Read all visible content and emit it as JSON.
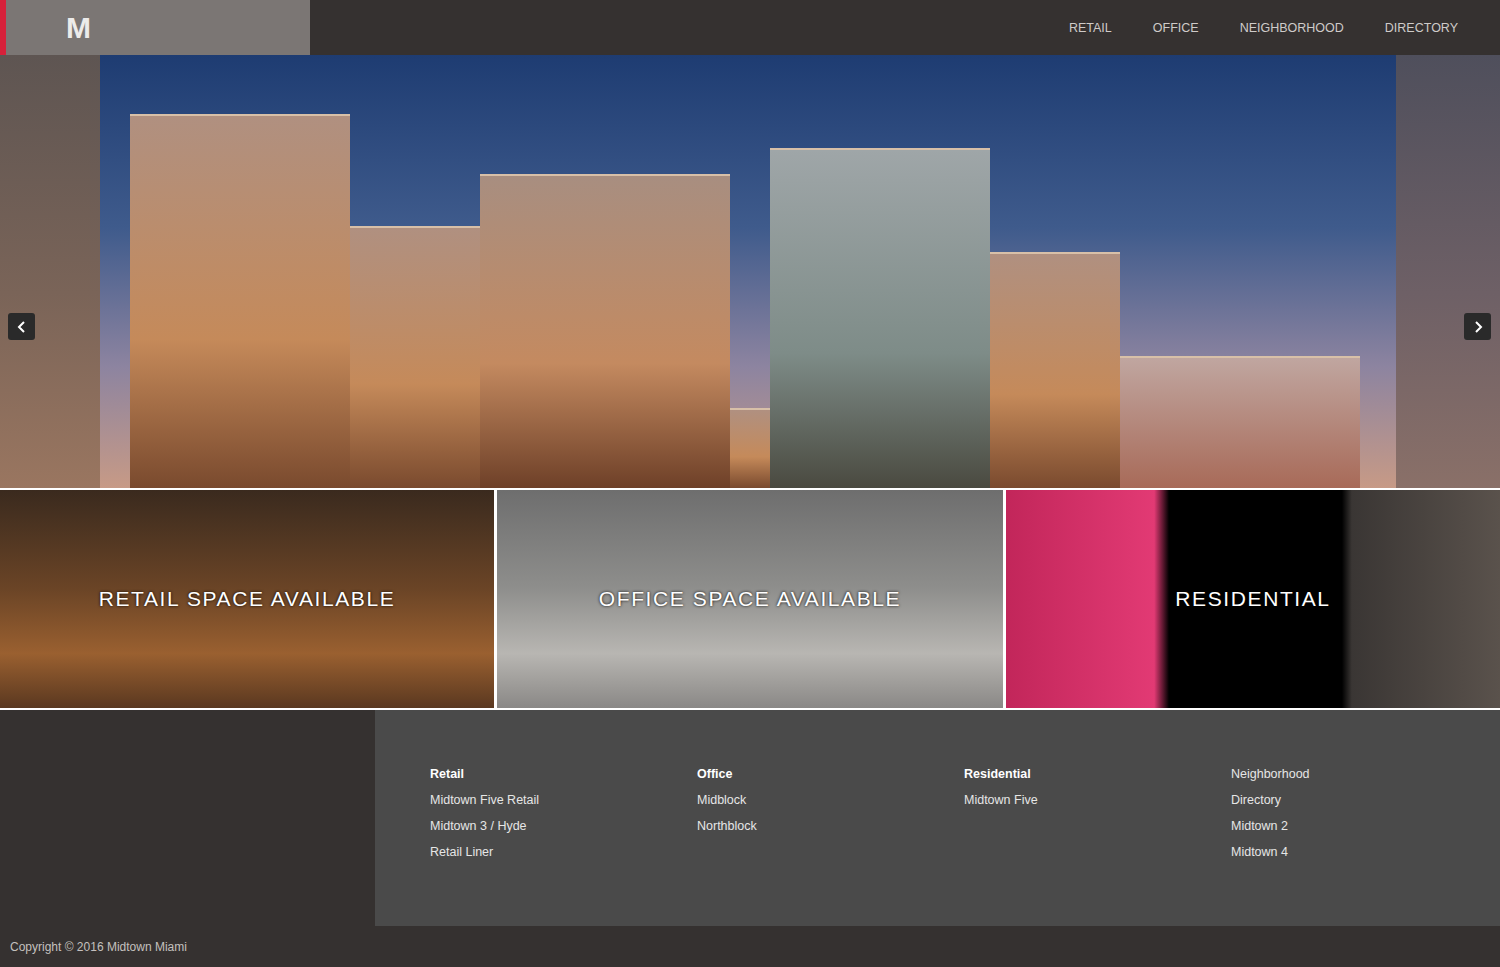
{
  "logo": {
    "text": "M"
  },
  "nav": [
    {
      "label": "RETAIL"
    },
    {
      "label": "OFFICE"
    },
    {
      "label": "NEIGHBORHOOD"
    },
    {
      "label": "DIRECTORY"
    }
  ],
  "tiles": [
    {
      "label": "RETAIL SPACE AVAILABLE"
    },
    {
      "label": "OFFICE SPACE AVAILABLE"
    },
    {
      "label": "RESIDENTIAL"
    }
  ],
  "footer": {
    "columns": [
      {
        "heading": "Retail",
        "links": [
          "Midtown Five Retail",
          "Midtown 3 / Hyde",
          "Retail Liner"
        ]
      },
      {
        "heading": "Office",
        "links": [
          "Midblock",
          "Northblock"
        ]
      },
      {
        "heading": "Residential",
        "links": [
          "Midtown Five"
        ]
      },
      {
        "heading": "",
        "links": [
          "Neighborhood",
          "Directory",
          "Midtown 2",
          "Midtown 4"
        ]
      }
    ]
  },
  "copyright": "Copyright © 2016 Midtown Miami"
}
